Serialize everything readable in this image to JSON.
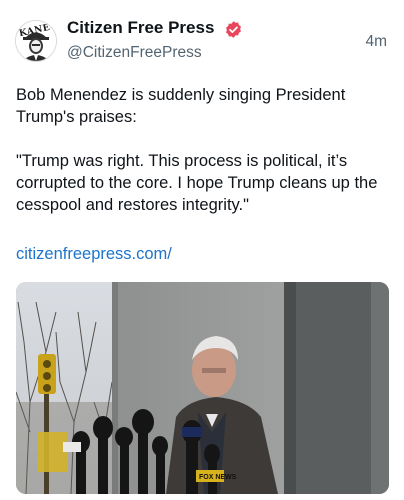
{
  "author": {
    "display_name": "Citizen Free Press",
    "handle": "@CitizenFreePress",
    "avatar_text": "KANE",
    "verified": true,
    "verified_color": "#e8465b"
  },
  "post": {
    "timestamp": "4m",
    "paragraphs": [
      "Bob Menendez is suddenly singing President Trump's praises:",
      "\"Trump was right. This process is political, it’s corrupted to the core. I hope Trump cleans up the cesspool and restores integrity.\""
    ],
    "link_text": "citizenfreepress.com/",
    "media": {
      "alt": "Man in a dark coat speaking at a bank of news microphones outside a building",
      "mic_label": "FOX NEWS"
    }
  },
  "colors": {
    "text": "#0f1419",
    "secondary": "#536471",
    "link": "#1d74c9"
  }
}
